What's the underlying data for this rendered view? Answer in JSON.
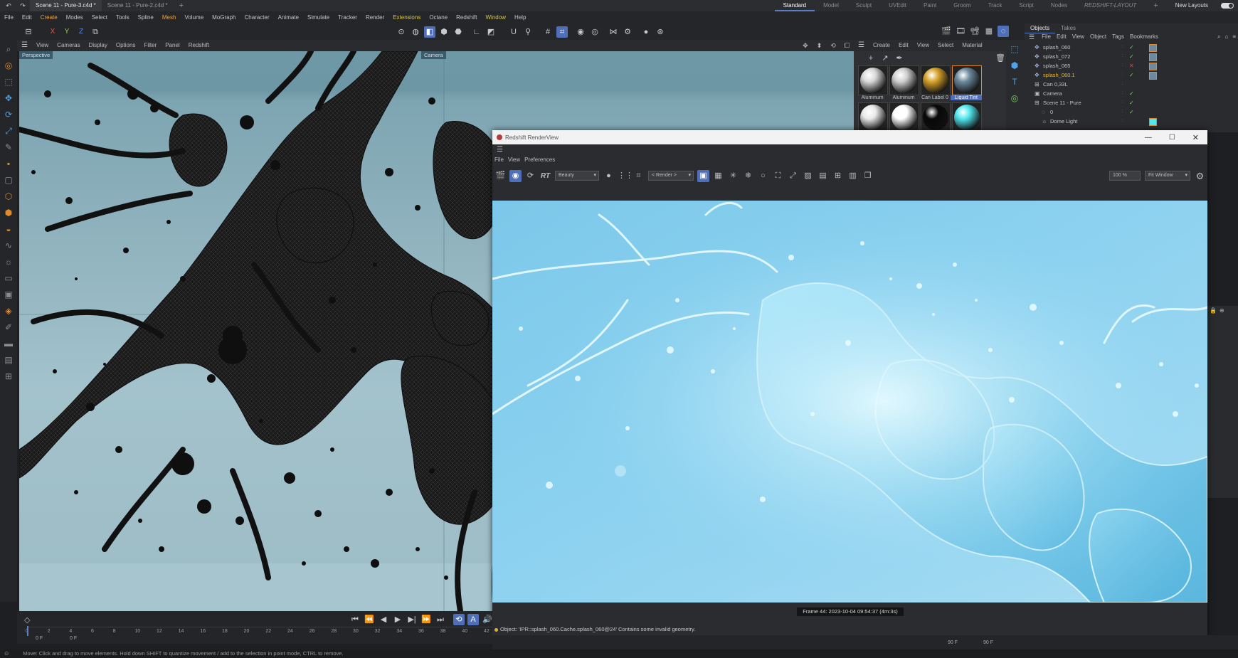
{
  "tabs": {
    "file_tabs": [
      "Scene 11 - Pure-3.c4d *",
      "Scene 11 - Pure-2.c4d *"
    ],
    "add": "+",
    "layouts": [
      "Standard",
      "Model",
      "Sculpt",
      "UVEdit",
      "Paint",
      "Groom",
      "Track",
      "Script",
      "Nodes",
      "REDSHIFT-LAYOUT"
    ],
    "new_layouts": "New Layouts"
  },
  "menubar": [
    "File",
    "Edit",
    "Create",
    "Modes",
    "Select",
    "Tools",
    "Spline",
    "Mesh",
    "Volume",
    "MoGraph",
    "Character",
    "Animate",
    "Simulate",
    "Tracker",
    "Render",
    "Extensions",
    "Octane",
    "Redshift",
    "Window",
    "Help"
  ],
  "toolbar": {
    "x": "X",
    "y": "Y",
    "z": "Z"
  },
  "viewport": {
    "menu": [
      "View",
      "Cameras",
      "Display",
      "Options",
      "Filter",
      "Panel",
      "Redshift"
    ],
    "label": "Perspective",
    "camera": "Camera"
  },
  "materials": {
    "menu": [
      "Create",
      "Edit",
      "View",
      "Select",
      "Material"
    ],
    "items": [
      {
        "label": "Aluminum",
        "color": "#d8d8d8"
      },
      {
        "label": "Aluminum",
        "color": "#cfcfcf"
      },
      {
        "label": "Can Label 0",
        "color": "#d6a22a"
      },
      {
        "label": "Liquid Tint",
        "color": "#6c8a9e"
      },
      {
        "label": "",
        "color": "#e9e9e9"
      },
      {
        "label": "",
        "color": "#ffffff"
      },
      {
        "label": "",
        "color": "#080808"
      },
      {
        "label": "",
        "color": "#52e8f0"
      }
    ]
  },
  "objects": {
    "tabs": [
      "Objects",
      "Takes"
    ],
    "menu": [
      "File",
      "Edit",
      "View",
      "Object",
      "Tags",
      "Bookmarks"
    ],
    "rows": [
      {
        "name": "splash_060"
      },
      {
        "name": "splash_072"
      },
      {
        "name": "splash_065"
      },
      {
        "name": "splash_060.1"
      },
      {
        "name": "Can 0,33L"
      },
      {
        "name": "Camera"
      },
      {
        "name": "Scene 11 - Pure"
      },
      {
        "name": "0"
      },
      {
        "name": "Dome Light"
      }
    ]
  },
  "renderview": {
    "title": "Redshift RenderView",
    "menu": [
      "File",
      "View",
      "Preferences"
    ],
    "rt_label": "RT",
    "aov": "Beauty",
    "render_dd": "< Render >",
    "zoom": "100 %",
    "fit": "Fit Window",
    "status": "Frame  44:  2023-10-04  09:54:37  (4m:3s)",
    "message": "Object: 'IPR::splash_060.Cache.splash_060@24' Contains some invalid geometry."
  },
  "timeline": {
    "ticks": [
      "0",
      "2",
      "4",
      "6",
      "8",
      "10",
      "12",
      "14",
      "16",
      "18",
      "20",
      "22",
      "24",
      "26",
      "28",
      "30",
      "32",
      "34",
      "36",
      "38",
      "40",
      "42"
    ],
    "current_frame": "0 F",
    "start_frame": "0 F",
    "end_frame_a": "90 F",
    "end_frame_b": "90 F"
  },
  "statusbar": {
    "text": "Move: Click and drag to move elements. Hold down SHIFT to quantize movement / add to the selection in point mode, CTRL to remove."
  }
}
